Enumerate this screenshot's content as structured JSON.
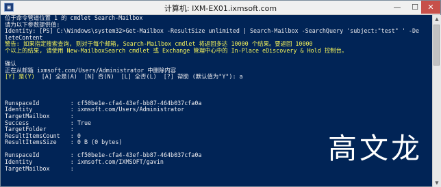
{
  "window": {
    "title": "计算机: IXM-EX01.ixmsoft.com",
    "controls": {
      "minimize": "—",
      "maximize": "☐",
      "close": "✕"
    }
  },
  "console": {
    "lines": [
      {
        "text": "位于命令管道位置 1 的 cmdlet Search-Mailbox",
        "style": "white"
      },
      {
        "text": "请为以下参数提供值:",
        "style": "white"
      },
      {
        "text": "Identity: [PS] C:\\Windows\\system32>Get-Mailbox -ResultSize unlimited | Search-Mailbox -SearchQuery 'subject:\"test\" ' -De",
        "style": "white"
      },
      {
        "text": "leteContent",
        "style": "white"
      },
      {
        "text": "警告: 如果指定搜索查询, 则对于每个邮箱, Search-Mailbox cmdlet 将返回多达 10000 个结果。要返回 10000",
        "style": "yellow"
      },
      {
        "text": "个以上的结果, 请使用 New-MailboxSearch cmdlet 或 Exchange 管理中心中的 In-Place eDiscovery & Hold 控制台。",
        "style": "yellow"
      },
      {
        "text": "",
        "style": "white"
      },
      {
        "text": "确认",
        "style": "white"
      },
      {
        "text": "正在从邮箱 ixmsoft.com/Users/Administrator 中删除内容",
        "style": "white"
      },
      {
        "text": "[Y] 是(Y)  [A] 全是(A)  [N] 否(N)  [L] 全否(L)  [?] 帮助 (默认值为\"Y\"): a",
        "style": "prompt"
      },
      {
        "text": "",
        "style": "white"
      },
      {
        "text": "",
        "style": "white"
      },
      {
        "text": "",
        "style": "white"
      },
      {
        "text": "RunspaceId         : cf50be1e-cfa4-43ef-bb87-464b037cfa0a",
        "style": "white"
      },
      {
        "text": "Identity           : ixmsoft.com/Users/Administrator",
        "style": "white"
      },
      {
        "text": "TargetMailbox      :",
        "style": "white"
      },
      {
        "text": "Success            : True",
        "style": "white"
      },
      {
        "text": "TargetFolder       :",
        "style": "white"
      },
      {
        "text": "ResultItemsCount   : 0",
        "style": "white"
      },
      {
        "text": "ResultItemsSize    : 0 B (0 bytes)",
        "style": "white"
      },
      {
        "text": "",
        "style": "white"
      },
      {
        "text": "RunspaceId         : cf50be1e-cfa4-43ef-bb87-464b037cfa0a",
        "style": "white"
      },
      {
        "text": "Identity           : ixmsoft.com/IXMSOFT/gavin",
        "style": "white"
      },
      {
        "text": "TargetMailbox      :",
        "style": "white"
      }
    ],
    "prompt_highlight": "[Y] 是(Y)",
    "prompt_rest": "  [A] 全是(A)  [N] 否(N)  [L] 全否(L)  [?] 帮助 (默认值为\"Y\"): a"
  },
  "watermark": {
    "text": "高文龙"
  },
  "colors": {
    "console_bg": "#012456",
    "console_text": "#eeedf0",
    "warning_text": "#f5f35a",
    "close_button": "#c7504a"
  },
  "icons": {
    "app": "remote-desktop-icon"
  }
}
